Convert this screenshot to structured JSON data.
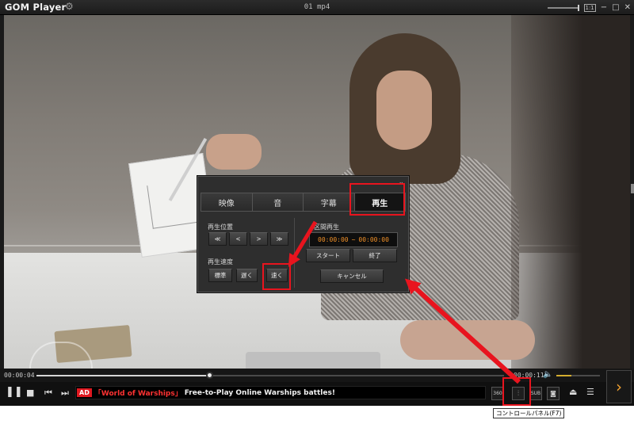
{
  "titlebar": {
    "logo": "GOM Player",
    "filename": "01 mp4",
    "icons": {
      "settings": "gear-icon",
      "minimize": "minimize-icon",
      "maximize": "maximize-icon",
      "close": "close-icon"
    },
    "screen_mode_label": "1:1"
  },
  "panel": {
    "tabs": [
      {
        "label": "映像"
      },
      {
        "label": "音"
      },
      {
        "label": "字幕"
      },
      {
        "label": "再生",
        "active": true
      }
    ],
    "position_label": "再生位置",
    "position_buttons": [
      "≪",
      "<",
      ">",
      "≫"
    ],
    "speed_label": "再生速度",
    "speed_buttons": [
      "標準",
      "遅く",
      "速く"
    ],
    "ab_label": "区間再生",
    "ab_start_time": "00:00:00",
    "ab_separator": "~",
    "ab_end_time": "00:00:00",
    "ab_start_button": "スタート",
    "ab_end_button": "終了",
    "cancel_button": "キャンセル"
  },
  "playback": {
    "current_time": "00:00:04",
    "total_time": "00:00:11",
    "progress": 0.37,
    "volume": 0.35
  },
  "ad": {
    "badge": "AD",
    "brand": "「World of Warships」",
    "text": "Free-to-Play Online Warships battles!"
  },
  "controls": {
    "sub_labels": [
      "360",
      "SUB"
    ],
    "icons": [
      "pause-icon",
      "stop-icon",
      "previous-icon",
      "next-icon",
      "control-panel-icon",
      "capture-icon",
      "eject-icon",
      "menu-icon",
      "next-file-icon"
    ]
  },
  "tooltip": "コントロールパネル(F7)",
  "colors": {
    "accent": "#f09028",
    "annotation_red": "#e8141e",
    "ad_red": "#e01820"
  }
}
